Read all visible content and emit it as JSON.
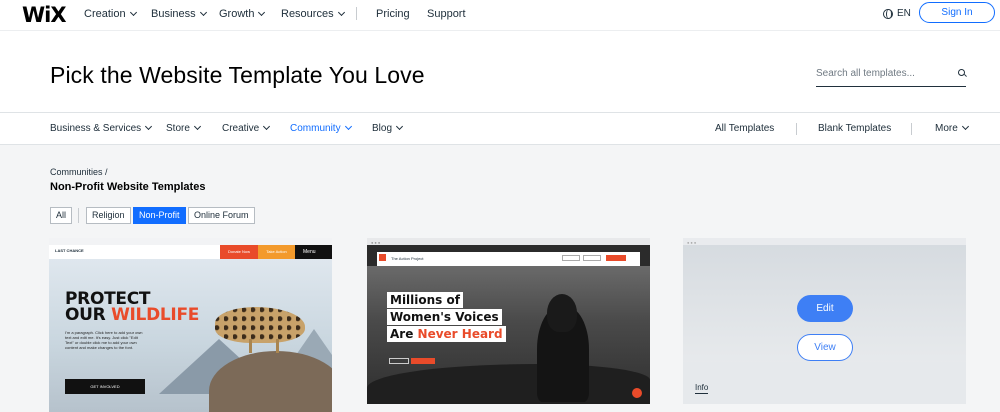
{
  "brand": {
    "logo": "WiX"
  },
  "topnav": {
    "items": [
      {
        "label": "Creation",
        "chevron": true
      },
      {
        "label": "Business",
        "chevron": true
      },
      {
        "label": "Growth",
        "chevron": true
      },
      {
        "label": "Resources",
        "chevron": true
      },
      {
        "label": "Pricing",
        "chevron": false
      },
      {
        "label": "Support",
        "chevron": false
      }
    ],
    "lang": "EN",
    "signin": "Sign In"
  },
  "hero": {
    "title": "Pick the Website Template You Love",
    "search_placeholder": "Search all templates..."
  },
  "categories": {
    "left": [
      {
        "label": "Business & Services",
        "active": false
      },
      {
        "label": "Store",
        "active": false
      },
      {
        "label": "Creative",
        "active": false
      },
      {
        "label": "Community",
        "active": true
      },
      {
        "label": "Blog",
        "active": false
      }
    ],
    "right": [
      {
        "label": "All Templates"
      },
      {
        "label": "Blank Templates"
      },
      {
        "label": "More"
      }
    ]
  },
  "breadcrumb": "Communities /",
  "subtitle": "Non-Profit Website Templates",
  "filters": [
    {
      "label": "All",
      "selected": false
    },
    {
      "label": "Religion",
      "selected": false
    },
    {
      "label": "Non-Profit",
      "selected": true
    },
    {
      "label": "Online Forum",
      "selected": false
    }
  ],
  "cards": {
    "c1": {
      "brand": "LAST CHANCE",
      "btn1": "Donate Now",
      "btn2": "Take Action",
      "menu": "Menu",
      "headline1": "PROTECT",
      "headline2a": "OUR ",
      "headline2b": "WILDLIFE",
      "paragraph": "I'm a paragraph. Click here to add your own text and edit me. It's easy. Just click \"Edit Text\" or double click me to add your own content and make changes to the font.",
      "cta": "GET INVOLVED"
    },
    "c2": {
      "brand": "The Action Project",
      "line1": "Millions of",
      "line2": "Women's Voices",
      "line3a": "Are ",
      "line3b": "Never Heard"
    },
    "c3": {
      "edit": "Edit",
      "view": "View",
      "info": "Info"
    }
  },
  "colors": {
    "accent": "#116dff",
    "brand_red": "#e94b2a",
    "orange": "#f39a2c"
  }
}
